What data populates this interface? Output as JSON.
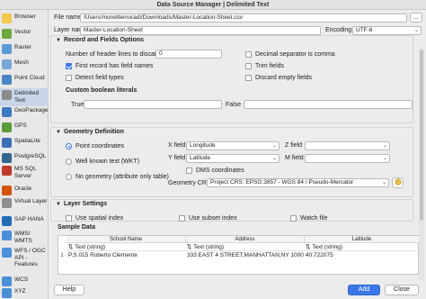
{
  "window": {
    "title": "Data Source Manager | Delimited Text"
  },
  "sidebar": {
    "items": [
      {
        "label": "Browser",
        "icon": "folder-icon",
        "color": "#f2c94c"
      },
      {
        "label": "Vector",
        "icon": "vector-icon",
        "color": "#6fa83f"
      },
      {
        "label": "Raster",
        "icon": "raster-icon",
        "color": "#5a9bd5"
      },
      {
        "label": "Mesh",
        "icon": "mesh-icon",
        "color": "#7aa7d8"
      },
      {
        "label": "Point Cloud",
        "icon": "point-cloud-icon",
        "color": "#4a86c5"
      },
      {
        "label": "Delimited Text",
        "icon": "delimited-text-icon",
        "color": "#8c8c8c"
      },
      {
        "label": "GeoPackage",
        "icon": "geopackage-icon",
        "color": "#3c7ac0"
      },
      {
        "label": "GPS",
        "icon": "gps-icon",
        "color": "#5b9b3a"
      },
      {
        "label": "SpatiaLite",
        "icon": "spatialite-icon",
        "color": "#3b6fb6"
      },
      {
        "label": "PostgreSQL",
        "icon": "postgresql-icon",
        "color": "#336791"
      },
      {
        "label": "MS SQL Server",
        "icon": "mssql-icon",
        "color": "#c0392b"
      },
      {
        "label": "Oracle",
        "icon": "oracle-icon",
        "color": "#d35400"
      },
      {
        "label": "Virtual Layer",
        "icon": "virtual-layer-icon",
        "color": "#8e8e8e"
      },
      {
        "label": "SAP HANA",
        "icon": "sap-hana-icon",
        "color": "#1f6fb5"
      },
      {
        "label": "WMS/ WMTS",
        "icon": "wms-icon",
        "color": "#4a90d9"
      },
      {
        "label": "WFS / OGC API - Features",
        "icon": "wfs-icon",
        "color": "#4a90d9"
      },
      {
        "label": "WCS",
        "icon": "wcs-icon",
        "color": "#4a90d9"
      },
      {
        "label": "XYZ",
        "icon": "xyz-icon",
        "color": "#4a90d9"
      }
    ]
  },
  "file": {
    "label": "File name",
    "value": "/Users/monettemoradi/Downloads/Master-Location-Sheet.csv",
    "browse": "…"
  },
  "layer": {
    "label": "Layer name",
    "value": "Master-Location-Sheet",
    "encoding_label": "Encoding",
    "encoding_value": "UTF-8"
  },
  "record_fields": {
    "title": "Record and Fields Options",
    "header_lines_label": "Number of header lines to discard",
    "header_lines_value": "0",
    "decimal_comma": "Decimal separator is comma",
    "first_record": "First record has field names",
    "trim_fields": "Trim fields",
    "detect_types": "Detect field types",
    "discard_empty": "Discard empty fields",
    "custom_bool_title": "Custom boolean literals",
    "true_label": "True",
    "false_label": "False"
  },
  "geometry": {
    "title": "Geometry Definition",
    "point_coords": "Point coordinates",
    "wkt": "Well known text (WKT)",
    "no_geometry": "No geometry (attribute only table)",
    "x_label": "X field",
    "x_value": "Longitude",
    "y_label": "Y field",
    "y_value": "Latitude",
    "z_label": "Z field",
    "m_label": "M field",
    "dms": "DMS coordinates",
    "crs_label": "Geometry CRS",
    "crs_value": "Project CRS: EPSG:3857 - WGS 84 / Pseudo-Mercator"
  },
  "layer_settings": {
    "title": "Layer Settings",
    "spatial_index": "Use spatial index",
    "subset_index": "Use subset index",
    "watch_file": "Watch file"
  },
  "sample": {
    "title": "Sample Data",
    "columns": [
      "School Name",
      "Address",
      "Latitude"
    ],
    "types": [
      "Text (string)",
      "Text (string)",
      "Text (string)"
    ],
    "rows": [
      [
        "1",
        "P.S.015 Roberto Clemente",
        "333 EAST 4 STREET,MANHATTAN,NY 10009",
        "40.722075"
      ]
    ]
  },
  "buttons": {
    "help": "Help",
    "add": "Add",
    "close": "Close"
  }
}
